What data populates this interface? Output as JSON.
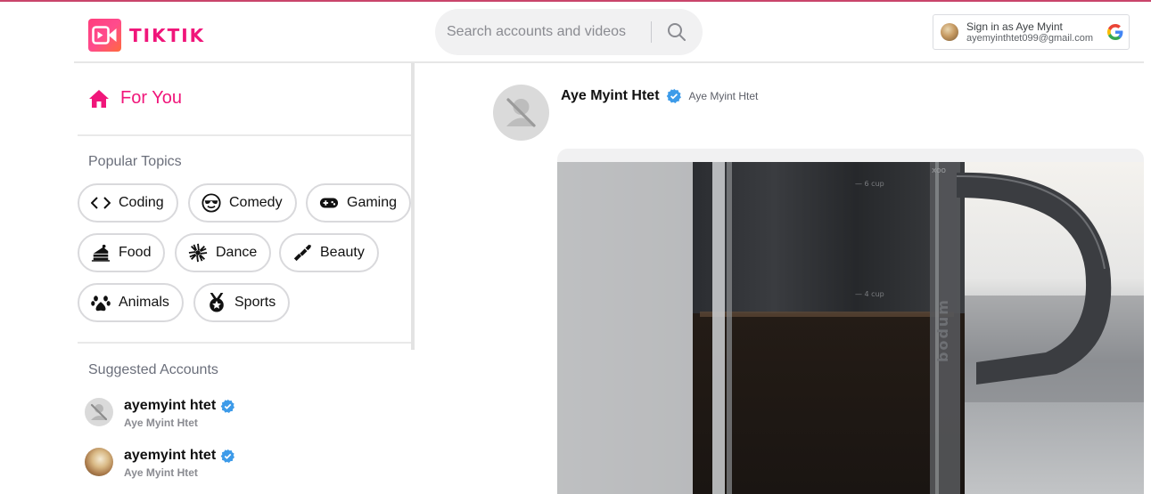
{
  "app": {
    "name": "TIKTIK",
    "brand_color": "#f0167a"
  },
  "header": {
    "search": {
      "placeholder": "Search accounts and videos",
      "icon": "search-icon"
    },
    "signin": {
      "label": "Sign in as Aye Myint",
      "email": "ayemyinthtet099@gmail.com",
      "icon": "google-icon"
    }
  },
  "sidebar": {
    "for_you": {
      "label": "For You",
      "icon": "home-icon"
    },
    "popular_title": "Popular Topics",
    "topics": [
      {
        "label": "Coding",
        "icon": "code-icon"
      },
      {
        "label": "Comedy",
        "icon": "sunglasses-face-icon"
      },
      {
        "label": "Gaming",
        "icon": "gamepad-icon"
      },
      {
        "label": "Food",
        "icon": "cake-icon"
      },
      {
        "label": "Dance",
        "icon": "dancer-icon"
      },
      {
        "label": "Beauty",
        "icon": "lipstick-icon"
      },
      {
        "label": "Animals",
        "icon": "paw-icon"
      },
      {
        "label": "Sports",
        "icon": "medal-icon"
      }
    ],
    "suggested_title": "Suggested Accounts",
    "accounts": [
      {
        "handle": "ayemyint htet",
        "name": "Aye Myint Htet",
        "avatar": "no-avatar-icon"
      },
      {
        "handle": "ayemyint htet",
        "name": "Aye Myint Htet",
        "avatar": "photo-avatar"
      }
    ]
  },
  "feed": {
    "post": {
      "handle": "Aye Myint Htet",
      "name": "Aye Myint Htet",
      "verified": true,
      "avatar": "no-avatar-icon",
      "video_text": {
        "mark_top": "— 6 cup",
        "mark_mid": "— 4 cup",
        "brand": "bodum",
        "tag": "xoo"
      }
    }
  }
}
